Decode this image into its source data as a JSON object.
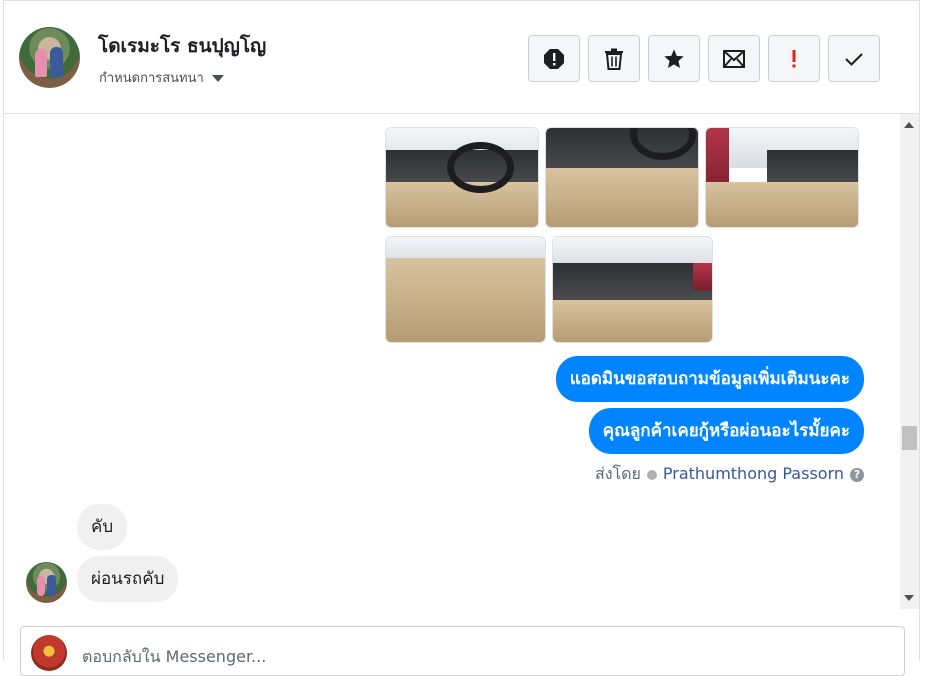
{
  "header": {
    "contact_name": "โดเรมะโร ธนปุญโญ",
    "conversation_menu_label": "กำหนดการสนทนา",
    "actions": [
      "block",
      "delete",
      "star",
      "mark-unread",
      "important",
      "done"
    ]
  },
  "conversation": {
    "photos_row1": [
      "car-interior-photo-1",
      "car-interior-photo-2",
      "car-interior-photo-3"
    ],
    "photos_row2": [
      "car-interior-photo-4",
      "car-interior-photo-5"
    ],
    "outgoing_messages": [
      "แอดมินขอสอบถามข้อมูลเพิ่มเติมนะคะ",
      "คุณลูกค้าเคยกู้หรือผ่อนอะไรมั้ยคะ"
    ],
    "sent_by_label": "ส่งโดย",
    "sent_by_name": "Prathumthong Passorn",
    "incoming_messages": [
      "คับ",
      "ผ่อนรถคับ"
    ]
  },
  "reply": {
    "placeholder": "ตอบกลับใน Messenger..."
  },
  "colors": {
    "accent_blue": "#0084ff",
    "incoming_bubble": "#f1f0f0",
    "important_red": "#e02020"
  }
}
